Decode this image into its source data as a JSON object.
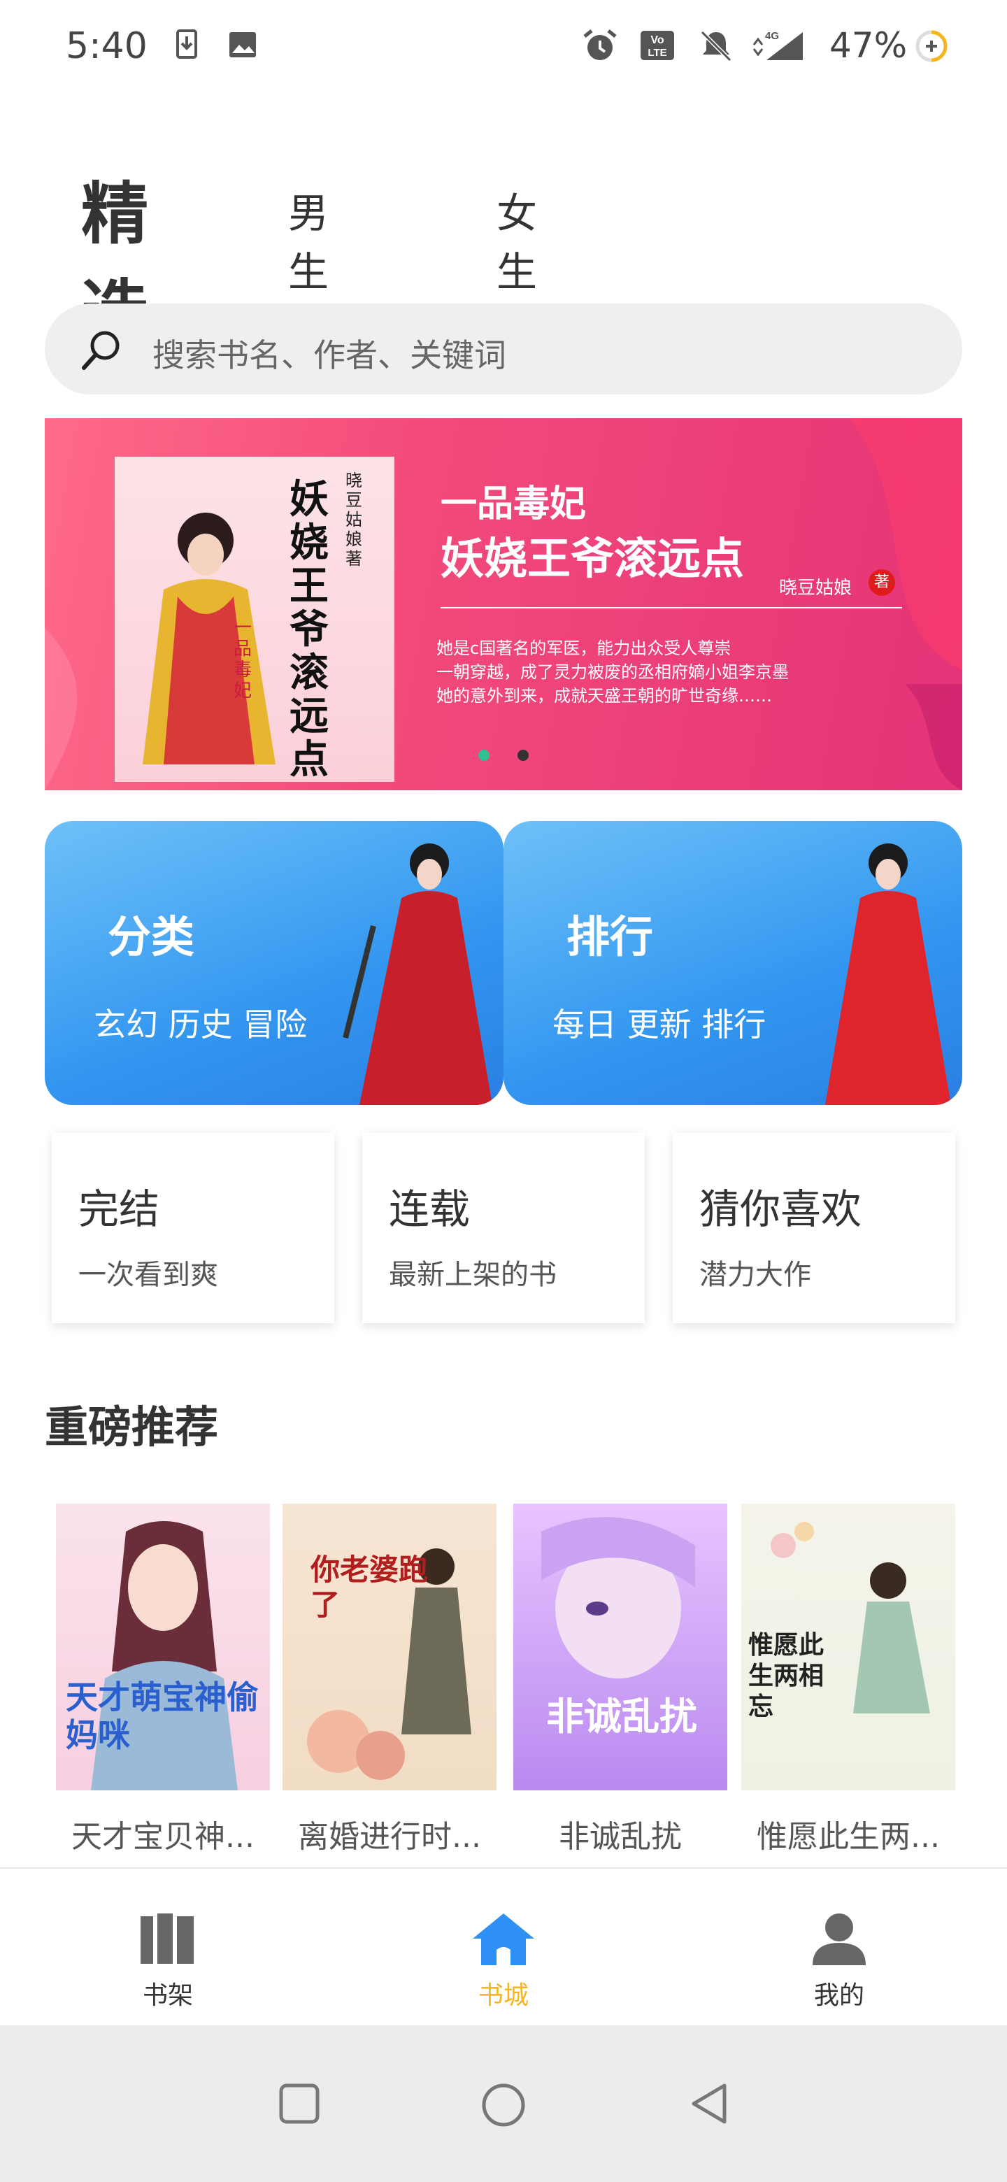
{
  "status_bar": {
    "time": "5:40",
    "battery": "47%"
  },
  "tabs": [
    {
      "label": "精选",
      "active": true
    },
    {
      "label": "男生",
      "active": false
    },
    {
      "label": "女生",
      "active": false
    }
  ],
  "search": {
    "placeholder": "搜索书名、作者、关键词"
  },
  "banner": {
    "cover_title": "妖娆王爷滚远点",
    "cover_subtitle": "一品毒妃",
    "cover_author": "晓豆姑娘著",
    "title_line1": "一品毒妃",
    "title_line2": "妖娆王爷滚远点",
    "author": "晓豆姑娘",
    "author_badge": "著",
    "blurb": "她是c国著名的军医，能力出众受人尊崇\n一朝穿越，成了灵力被废的丞相府嫡小姐李京墨\n她的意外到来，成就天盛王朝的旷世奇缘……",
    "active_dot": 0
  },
  "category_cards": [
    {
      "title": "分类",
      "subtitle": "玄幻 历史 冒险"
    },
    {
      "title": "排行",
      "subtitle": "每日 更新 排行"
    }
  ],
  "tiles": [
    {
      "title": "完结",
      "subtitle": "一次看到爽"
    },
    {
      "title": "连载",
      "subtitle": "最新上架的书"
    },
    {
      "title": "猜你喜欢",
      "subtitle": "潜力大作"
    }
  ],
  "recommend": {
    "title": "重磅推荐",
    "books": [
      {
        "title": "天才宝贝神...",
        "cover_text": "天才萌宝神偷妈咪"
      },
      {
        "title": "离婚进行时...",
        "cover_text": "你老婆跑了"
      },
      {
        "title": "非诚乱扰",
        "cover_text": "非诚乱扰"
      },
      {
        "title": "惟愿此生两...",
        "cover_text": "惟愿此生两相忘"
      }
    ]
  },
  "bottom_nav": [
    {
      "label": "书架",
      "icon": "bookshelf-icon",
      "active": false
    },
    {
      "label": "书城",
      "icon": "home-icon",
      "active": true
    },
    {
      "label": "我的",
      "icon": "person-icon",
      "active": false
    }
  ],
  "colors": {
    "accent": "#f5b51f",
    "nav_icon": "#666666",
    "home_icon": "#2e8ff5",
    "card_blue": "#3296f0",
    "banner_pink": "#f24a7a"
  }
}
